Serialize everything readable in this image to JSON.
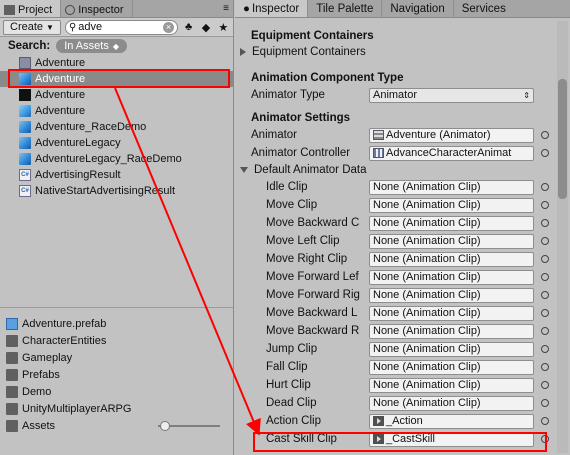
{
  "project_panel": {
    "tabs": [
      {
        "label": "Project",
        "active": true
      },
      {
        "label": "Inspector",
        "active": false
      }
    ],
    "create_label": "Create",
    "search_value": "adve",
    "search_label": "Search:",
    "search_scope": "In Assets",
    "results": [
      {
        "label": "Adventure",
        "icon": "script-gear-icon",
        "selected": false
      },
      {
        "label": "Adventure",
        "icon": "prefab-cube-icon",
        "selected": true
      },
      {
        "label": "Adventure",
        "icon": "unity-scene-icon",
        "selected": false
      },
      {
        "label": "Adventure",
        "icon": "prefab-variant-icon",
        "selected": false
      },
      {
        "label": "Adventure_RaceDemo",
        "icon": "prefab-cube-icon",
        "selected": false
      },
      {
        "label": "AdventureLegacy",
        "icon": "prefab-cube-icon",
        "selected": false
      },
      {
        "label": "AdventureLegacy_RaceDemo",
        "icon": "prefab-cube-icon",
        "selected": false
      },
      {
        "label": "AdvertisingResult",
        "icon": "csharp-script-icon",
        "selected": false
      },
      {
        "label": "NativeStartAdvertisingResult",
        "icon": "csharp-script-icon",
        "selected": false
      }
    ],
    "folders": [
      {
        "label": "Adventure.prefab",
        "icon": "prefab-cube-icon"
      },
      {
        "label": "CharacterEntities",
        "icon": "folder-icon"
      },
      {
        "label": "Gameplay",
        "icon": "folder-icon"
      },
      {
        "label": "Prefabs",
        "icon": "folder-icon"
      },
      {
        "label": "Demo",
        "icon": "folder-icon"
      },
      {
        "label": "UnityMultiplayerARPG",
        "icon": "folder-icon"
      },
      {
        "label": "Assets",
        "icon": "folder-icon"
      }
    ]
  },
  "inspector_panel": {
    "tabs": [
      {
        "label": "Inspector",
        "active": true
      },
      {
        "label": "Tile Palette",
        "active": false
      },
      {
        "label": "Navigation",
        "active": false
      },
      {
        "label": "Services",
        "active": false
      }
    ],
    "equipment_header": "Equipment Containers",
    "equipment_foldout": "Equipment Containers",
    "anim_type_header": "Animation Component Type",
    "animator_type_label": "Animator Type",
    "animator_type_value": "Animator",
    "animator_settings_header": "Animator Settings",
    "animator_label": "Animator",
    "animator_value": "Adventure (Animator)",
    "animator_controller_label": "Animator Controller",
    "animator_controller_value": "AdvanceCharacterAnimat",
    "default_anim_data_label": "Default Animator Data",
    "clips": [
      {
        "label": "Idle Clip",
        "value": "None (Animation Clip)",
        "has_icon": false
      },
      {
        "label": "Move Clip",
        "value": "None (Animation Clip)",
        "has_icon": false
      },
      {
        "label": "Move Backward C",
        "value": "None (Animation Clip)",
        "has_icon": false
      },
      {
        "label": "Move Left Clip",
        "value": "None (Animation Clip)",
        "has_icon": false
      },
      {
        "label": "Move Right Clip",
        "value": "None (Animation Clip)",
        "has_icon": false
      },
      {
        "label": "Move Forward Lef",
        "value": "None (Animation Clip)",
        "has_icon": false
      },
      {
        "label": "Move Forward Rig",
        "value": "None (Animation Clip)",
        "has_icon": false
      },
      {
        "label": "Move Backward L",
        "value": "None (Animation Clip)",
        "has_icon": false
      },
      {
        "label": "Move Backward R",
        "value": "None (Animation Clip)",
        "has_icon": false
      },
      {
        "label": "Jump Clip",
        "value": "None (Animation Clip)",
        "has_icon": false
      },
      {
        "label": "Fall Clip",
        "value": "None (Animation Clip)",
        "has_icon": false
      },
      {
        "label": "Hurt Clip",
        "value": "None (Animation Clip)",
        "has_icon": false
      },
      {
        "label": "Dead Clip",
        "value": "None (Animation Clip)",
        "has_icon": false
      },
      {
        "label": "Action Clip",
        "value": "_Action",
        "has_icon": true
      },
      {
        "label": "Cast Skill Clip",
        "value": "_CastSkill",
        "has_icon": true
      }
    ]
  },
  "colors": {
    "highlight": "#ff0000",
    "selection": "#8a8a8a"
  }
}
